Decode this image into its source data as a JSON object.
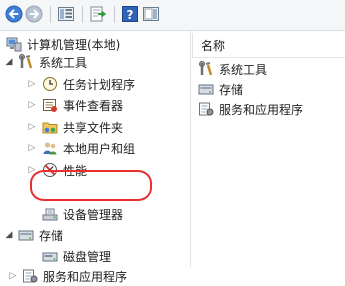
{
  "toolbar": {
    "buttons": [
      "back-icon",
      "forward-icon",
      "up-one-level-icon",
      "show-hide-tree-icon",
      "export-list-icon",
      "help-icon",
      "show-hide-action-pane-icon"
    ]
  },
  "tree": {
    "root": "计算机管理(本地)",
    "system_tools": "系统工具",
    "task_scheduler": "任务计划程序",
    "event_viewer": "事件查看器",
    "shared_folders": "共享文件夹",
    "local_users": "本地用户和组",
    "performance": "性能",
    "device_manager": "设备管理器",
    "storage": "存储",
    "disk_management": "磁盘管理",
    "services_apps": "服务和应用程序"
  },
  "list": {
    "column_name": "名称",
    "items": [
      "系统工具",
      "存储",
      "服务和应用程序"
    ]
  },
  "colors": {
    "highlight": "#e8302f"
  }
}
